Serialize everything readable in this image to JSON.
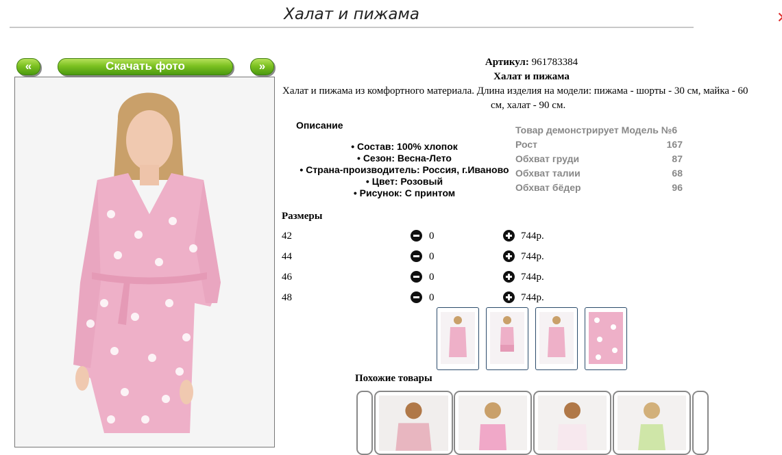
{
  "page": {
    "title": "Халат и пижама"
  },
  "gallery": {
    "prev_label": "«",
    "download_label": "Скачать фото",
    "next_label": "»"
  },
  "product": {
    "article_label": "Артикул:",
    "article_value": "961783384",
    "name": "Халат и пижама",
    "description_line1": "Халат и пижама из комфортного материала. Длина изделия на модели: пижама - шорты - 30 см, майка - 60",
    "description_line2": "см, халат - 90 см."
  },
  "description": {
    "title": "Описание",
    "items": [
      "• Состав: 100% хлопок",
      "• Сезон: Весна-Лето",
      "• Страна-производитель: Россия, г.Иваново",
      "• Цвет: Розовый",
      "• Рисунок: С принтом"
    ]
  },
  "model": {
    "heading": "Товар демонстрирует Модель №6",
    "rows": [
      {
        "label": "Рост",
        "value": "167"
      },
      {
        "label": "Обхват груди",
        "value": "87"
      },
      {
        "label": "Обхват талии",
        "value": "68"
      },
      {
        "label": "Обхват бёдер",
        "value": "96"
      }
    ]
  },
  "sizes": {
    "title": "Размеры",
    "rows": [
      {
        "size": "42",
        "qty": "0",
        "price": "744р."
      },
      {
        "size": "44",
        "qty": "0",
        "price": "744р."
      },
      {
        "size": "46",
        "qty": "0",
        "price": "744р."
      },
      {
        "size": "48",
        "qty": "0",
        "price": "744р."
      }
    ]
  },
  "similar": {
    "title": "Похожие товары"
  },
  "colors": {
    "accent_green": "#6cb51e",
    "robe_pink": "#eeb0c8",
    "close_red": "#e03030"
  },
  "icons": {
    "minus": "minus-circle-icon",
    "plus": "plus-circle-icon",
    "close": "close-icon"
  }
}
